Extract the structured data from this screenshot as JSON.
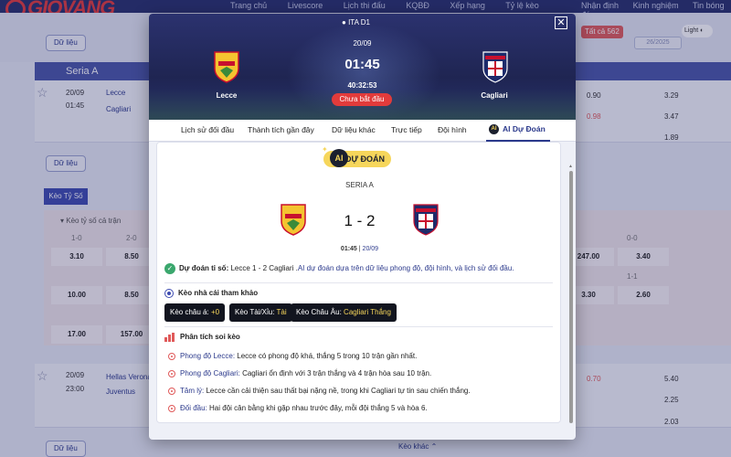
{
  "site": {
    "logo": "GIOVANG",
    "nav_left": [
      "Trang chủ",
      "Livescore",
      "Lịch thi đấu",
      "KQBĐ",
      "Xếp hạng",
      "Tỷ lệ kèo"
    ],
    "nav_right": [
      "Nhận định",
      "Kinh nghiệm",
      "Tin bóng đá"
    ],
    "data_button": "Dữ liệu",
    "filter_all": "Tất cả",
    "filter_count": "562",
    "date_filter": "26/2025",
    "light_toggle": "Light",
    "league_name": "Seria A",
    "odds_tab": "Kèo Tỷ Số",
    "odds_section": "Kèo tỷ số cả trận",
    "more_odds": "Kèo khác",
    "bg_match1": {
      "date": "20/09",
      "time": "01:45",
      "home": "Lecce",
      "away": "Cagliari",
      "odds": [
        "0.90",
        "3.29",
        "0.98",
        "3.47",
        "1.89"
      ]
    },
    "bg_match2": {
      "date": "20/09",
      "time": "23:00",
      "home": "Hellas Verona",
      "away": "Juventus",
      "odds": [
        "0.70",
        "5.40",
        "2.25",
        "2.03"
      ]
    },
    "score_headers": [
      "1-0",
      "2-0",
      "0-0",
      "1-1"
    ],
    "score_values": [
      "3.10",
      "8.50",
      "10.00",
      "8.50",
      "17.00",
      "157.00",
      "247.00",
      "3.40",
      "3.30",
      "2.60"
    ]
  },
  "modal": {
    "league": "ITA D1",
    "date": "20/09",
    "time": "01:45",
    "countdown": "40:32:53",
    "status": "Chưa bắt đầu",
    "home_team": "Lecce",
    "away_team": "Cagliari",
    "close": "✕",
    "tabs": [
      "Lịch sử đối đầu",
      "Thành tích gần đây",
      "Dữ liệu khác",
      "Trực tiếp",
      "Đội hình",
      "AI Dự Đoán"
    ],
    "ai_badge": "AI",
    "prediction": {
      "pill": "DỰ ĐOÁN",
      "league": "SERIA A",
      "score": "1 - 2",
      "time": "01:45",
      "date": "20/09",
      "label": "Dự đoán tỉ số:",
      "text_plain": "Lecce 1 - 2 Cagliari .",
      "text_blue": "AI dự đoán dựa trên dữ liệu phong độ, đội hình, và lịch sử đối đầu."
    },
    "bookmaker": {
      "title": "Kèo nhà cái tham khảo",
      "asian_label": "Kèo châu á:",
      "asian_value": "+0",
      "ou_label": "Kèo Tài/Xỉu:",
      "ou_value": "Tài",
      "eu_label": "Kèo Châu Âu:",
      "eu_value": "Cagliari Thắng"
    },
    "analysis": {
      "title": "Phân tích soi kèo",
      "items": [
        {
          "key": "Phong độ Lecce:",
          "text": "Lecce có phong độ khá, thắng 5 trong 10 trận gần nhất."
        },
        {
          "key": "Phong độ Cagliari:",
          "text": "Cagliari ổn định với 3 trận thắng và 4 trận hòa sau 10 trận."
        },
        {
          "key": "Tâm lý:",
          "text": "Lecce cần cải thiện sau thất bại nặng nề, trong khi Cagliari tự tin sau chiến thắng."
        },
        {
          "key": "Đối đầu:",
          "text": "Hai đội cân bằng khi gặp nhau trước đây, mỗi đội thắng 5 và hòa 6."
        }
      ]
    }
  },
  "colors": {
    "navy": "#27306b",
    "accent_blue": "#2c3a8c",
    "red": "#e23b3b",
    "gold": "#f6d65b",
    "green": "#3aa76d"
  },
  "icons": [
    "star-icon",
    "close-icon",
    "check-icon",
    "gear-icon",
    "chart-icon",
    "target-icon",
    "ai-icon",
    "lecce-crest",
    "cagliari-crest"
  ]
}
